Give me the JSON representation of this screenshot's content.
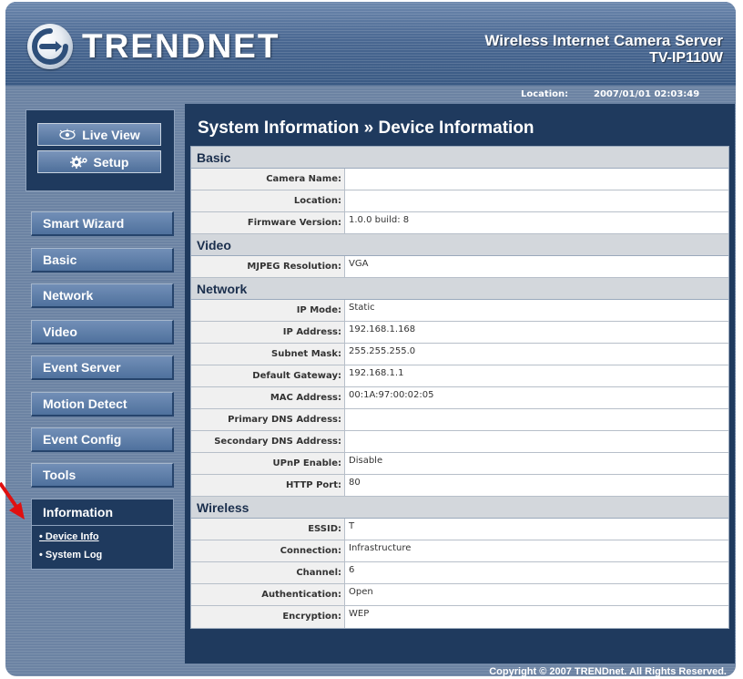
{
  "header": {
    "logo_text": "TRENDNET",
    "product_title": "Wireless Internet Camera Server",
    "model": "TV-IP110W",
    "location_label": "Location:",
    "datetime": "2007/01/01 02:03:49"
  },
  "mode_buttons": {
    "live_view": "Live View",
    "setup": "Setup"
  },
  "nav": {
    "items": [
      "Smart Wizard",
      "Basic",
      "Network",
      "Video",
      "Event Server",
      "Motion Detect",
      "Event Config",
      "Tools",
      "Information"
    ],
    "active": "Information",
    "sub_items": [
      "Device Info",
      "System Log"
    ]
  },
  "page": {
    "title": "System Information » Device Information"
  },
  "sections": [
    {
      "title": "Basic",
      "rows": [
        {
          "label": "Camera Name:",
          "value": ""
        },
        {
          "label": "Location:",
          "value": ""
        },
        {
          "label": "Firmware Version:",
          "value": "1.0.0 build: 8"
        }
      ]
    },
    {
      "title": "Video",
      "rows": [
        {
          "label": "MJPEG Resolution:",
          "value": "VGA"
        }
      ]
    },
    {
      "title": "Network",
      "rows": [
        {
          "label": "IP Mode:",
          "value": "Static"
        },
        {
          "label": "IP Address:",
          "value": "192.168.1.168"
        },
        {
          "label": "Subnet Mask:",
          "value": "255.255.255.0"
        },
        {
          "label": "Default Gateway:",
          "value": "192.168.1.1"
        },
        {
          "label": "MAC Address:",
          "value": "00:1A:97:00:02:05"
        },
        {
          "label": "Primary DNS Address:",
          "value": ""
        },
        {
          "label": "Secondary DNS Address:",
          "value": ""
        },
        {
          "label": "UPnP Enable:",
          "value": "Disable"
        },
        {
          "label": "HTTP Port:",
          "value": "80"
        }
      ]
    },
    {
      "title": "Wireless",
      "rows": [
        {
          "label": "ESSID:",
          "value": "T"
        },
        {
          "label": "Connection:",
          "value": "Infrastructure"
        },
        {
          "label": "Channel:",
          "value": "6"
        },
        {
          "label": "Authentication:",
          "value": "Open"
        },
        {
          "label": "Encryption:",
          "value": "WEP"
        }
      ]
    }
  ],
  "footer": {
    "copyright": "Copyright © 2007 TRENDnet. All Rights Reserved."
  },
  "colors": {
    "nav_active": "#1f3a5e",
    "button_top": "#728fb7",
    "section_bg": "#d3d7dc",
    "arrow": "#e01010"
  },
  "icons": {
    "logo": "trendnet-logo-icon",
    "live_view": "camera-eye-icon",
    "setup": "gears-icon",
    "pointer": "red-arrow-icon"
  }
}
